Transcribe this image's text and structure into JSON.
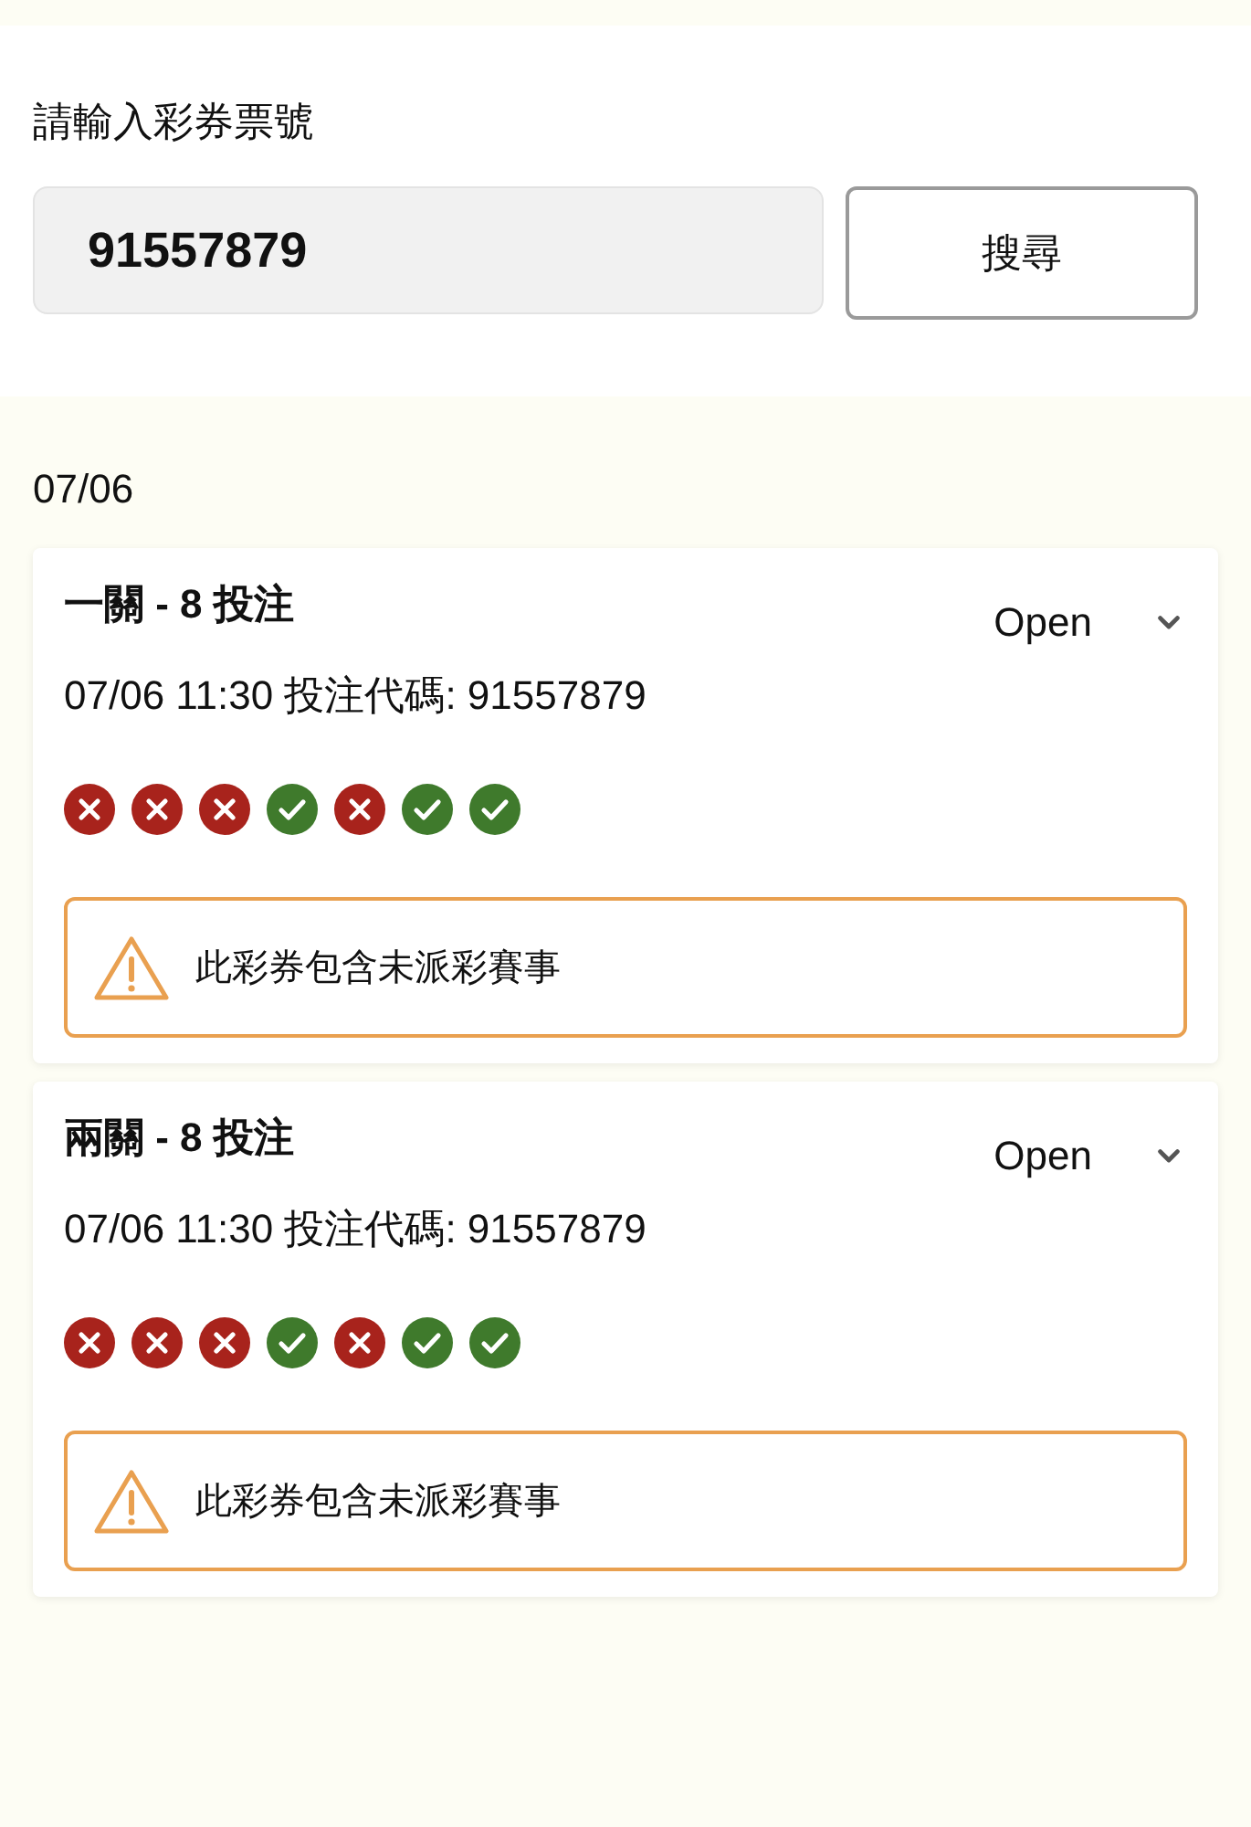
{
  "search": {
    "label": "請輸入彩券票號",
    "value": "91557879",
    "button": "搜尋"
  },
  "groups": [
    {
      "date": "07/06",
      "tickets": [
        {
          "title": "一關 - 8 投注",
          "status": "Open",
          "expanded": false,
          "detail": "07/06 11:30 投注代碼: 91557879",
          "results": [
            {
              "kind": "lose"
            },
            {
              "kind": "lose"
            },
            {
              "kind": "lose"
            },
            {
              "kind": "win"
            },
            {
              "kind": "lose"
            },
            {
              "kind": "win"
            },
            {
              "kind": "win"
            }
          ],
          "warning": "此彩券包含未派彩賽事"
        },
        {
          "title": "兩關 - 8 投注",
          "status": "Open",
          "expanded": false,
          "detail": "07/06 11:30 投注代碼: 91557879",
          "results": [
            {
              "kind": "lose"
            },
            {
              "kind": "lose"
            },
            {
              "kind": "lose"
            },
            {
              "kind": "win"
            },
            {
              "kind": "lose"
            },
            {
              "kind": "win"
            },
            {
              "kind": "win"
            }
          ],
          "warning": "此彩券包含未派彩賽事"
        }
      ]
    }
  ]
}
